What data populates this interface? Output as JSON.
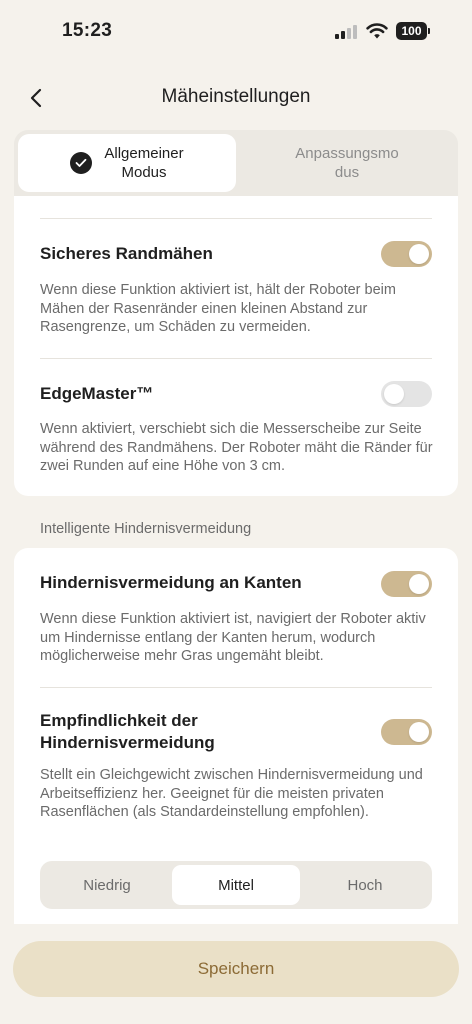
{
  "status_bar": {
    "time": "15:23",
    "battery": "100",
    "icons": [
      "cellular-signal-icon",
      "wifi-icon",
      "battery-icon"
    ]
  },
  "header": {
    "title": "Mäheinstellungen",
    "back_icon": "chevron-left-icon"
  },
  "mode_tabs": [
    {
      "label": "Allgemeiner Modus",
      "line1": "Allgemeiner",
      "line2": "Modus",
      "selected": true
    },
    {
      "label": "Anpassungsmodus",
      "line1": "Anpassungsmo",
      "line2": "dus",
      "selected": false
    }
  ],
  "edge_settings": [
    {
      "title": "Sicheres Randmähen",
      "description": "Wenn diese Funktion aktiviert ist, hält der Roboter beim Mähen der Rasenränder einen kleinen Abstand zur Rasengrenze, um Schäden zu vermeiden.",
      "enabled": true
    },
    {
      "title": "EdgeMaster™",
      "description": "Wenn aktiviert, verschiebt sich die Messerscheibe zur Seite während des Randmähens. Der Roboter mäht die Ränder für zwei Runden auf eine Höhe von 3 cm.",
      "enabled": false
    }
  ],
  "obstacle_section": {
    "label": "Intelligente Hindernisvermeidung",
    "edge_avoidance": {
      "title": "Hindernisvermeidung an Kanten",
      "description": "Wenn diese Funktion aktiviert ist, navigiert der Roboter aktiv um Hindernisse entlang der Kanten herum, wodurch möglicherweise mehr Gras ungemäht bleibt.",
      "enabled": true
    },
    "sensitivity": {
      "title_line1": "Empfindlichkeit der",
      "title_line2": "Hindernisvermeidung",
      "description": "Stellt ein Gleichgewicht zwischen Hindernisvermeidung und Arbeitseffizienz her. Geeignet für die meisten privaten Rasenflächen (als Standardeinstellung empfohlen).",
      "enabled": true,
      "levels": [
        "Niedrig",
        "Mittel",
        "Hoch"
      ],
      "selected": "Mittel"
    }
  },
  "save_label": "Speichern",
  "colors": {
    "background": "#F5F2EC",
    "toggle_on": "#CDB891",
    "toggle_off": "#E4E4E4",
    "save_button_bg": "#EAE0C7",
    "save_button_text": "#8C6B36"
  }
}
